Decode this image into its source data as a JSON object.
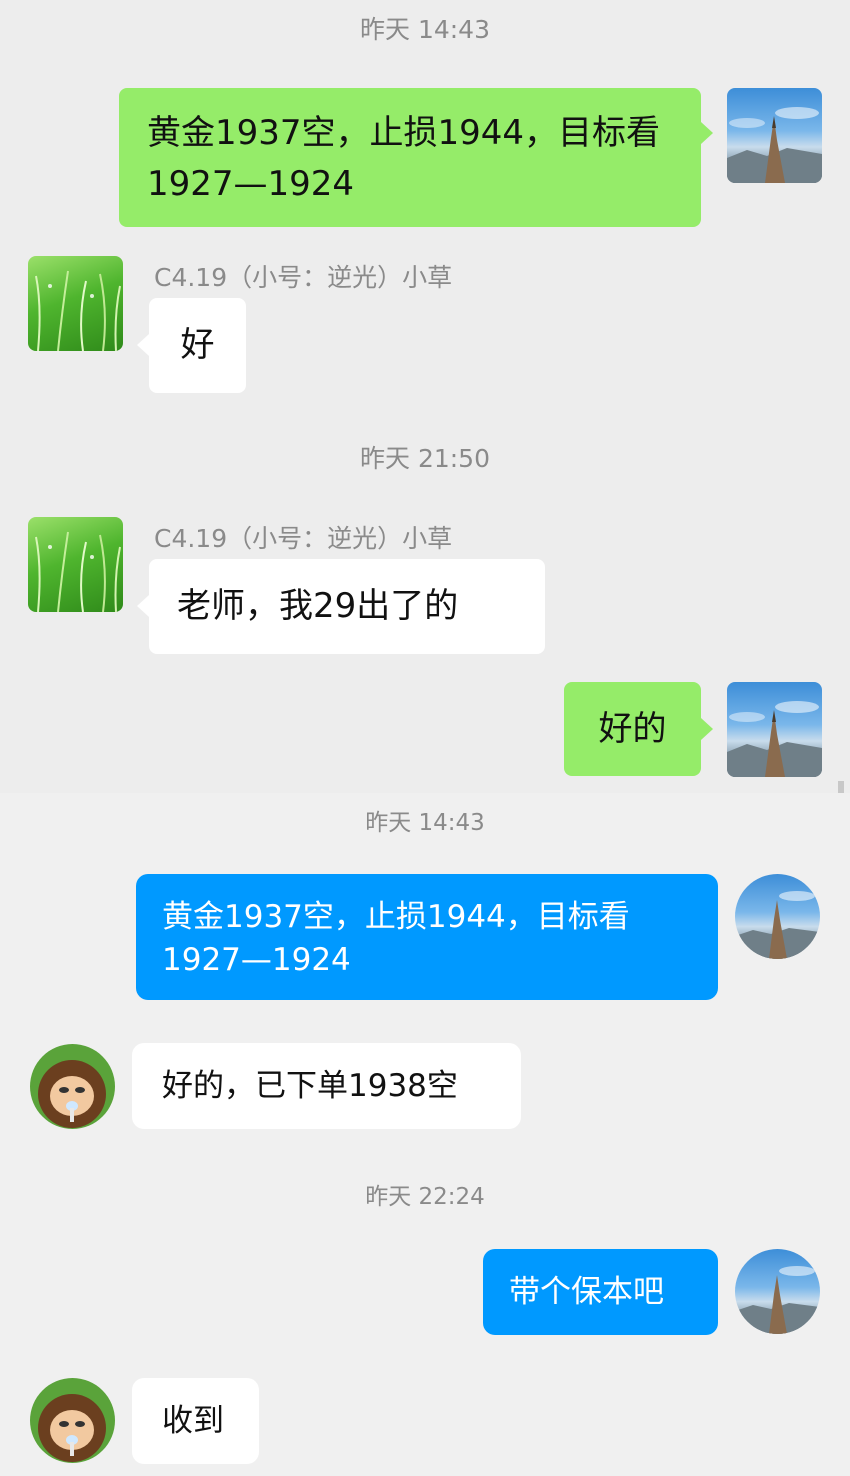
{
  "wechat": {
    "timestamp_1": "昨天 14:43",
    "msg_out_1": "黄金1937空，止损1944，目标看1927—1924",
    "sender_1": "C4.19（小号：逆光）小草",
    "msg_in_1": "好",
    "timestamp_2": "昨天 21:50",
    "sender_2": "C4.19（小号：逆光）小草",
    "msg_in_2": "老师，我29出了的",
    "msg_out_2": "好的"
  },
  "qq": {
    "timestamp_1": "昨天 14:43",
    "msg_out_1": "黄金1937空，止损1944，目标看1927—1924",
    "msg_in_1": "好的，已下单1938空",
    "timestamp_2": "昨天 22:24",
    "msg_out_2": "带个保本吧",
    "msg_in_2": "收到"
  },
  "icons": {
    "self_avatar": "mountain-peak-avatar",
    "contact_avatar_wechat": "green-grass-avatar",
    "contact_avatar_qq": "cartoon-bear-avatar"
  },
  "colors": {
    "wechat_out_bubble": "#95ec69",
    "qq_out_bubble": "#0099ff",
    "in_bubble": "#ffffff"
  }
}
